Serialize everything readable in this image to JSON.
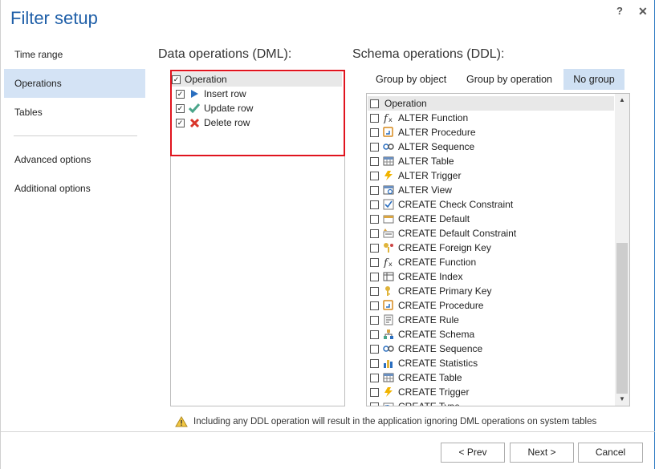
{
  "window": {
    "title": "Filter setup",
    "help_label": "?",
    "close_label": "✕"
  },
  "nav": {
    "items_top": [
      {
        "label": "Time range"
      },
      {
        "label": "Operations"
      },
      {
        "label": "Tables"
      }
    ],
    "items_bottom": [
      {
        "label": "Advanced options"
      },
      {
        "label": "Additional options"
      }
    ],
    "active": "Operations"
  },
  "dml": {
    "title": "Data operations (DML):",
    "header": {
      "label": "Operation",
      "checked": true
    },
    "items": [
      {
        "label": "Insert row",
        "checked": true,
        "icon": "play-arrow-icon",
        "color": "#2a6ebf"
      },
      {
        "label": "Update row",
        "checked": true,
        "icon": "checkmark-icon",
        "color": "#4aa58a"
      },
      {
        "label": "Delete row",
        "checked": true,
        "icon": "red-x-icon",
        "color": "#d9362b"
      }
    ]
  },
  "ddl": {
    "title": "Schema operations (DDL):",
    "tabs": [
      {
        "label": "Group by object"
      },
      {
        "label": "Group by operation"
      },
      {
        "label": "No group"
      }
    ],
    "active_tab": "No group",
    "header": {
      "label": "Operation",
      "checked": false
    },
    "items": [
      {
        "label": "ALTER Function",
        "icon": "function-icon"
      },
      {
        "label": "ALTER Procedure",
        "icon": "procedure-icon"
      },
      {
        "label": "ALTER Sequence",
        "icon": "sequence-icon"
      },
      {
        "label": "ALTER Table",
        "icon": "table-icon"
      },
      {
        "label": "ALTER Trigger",
        "icon": "trigger-icon"
      },
      {
        "label": "ALTER View",
        "icon": "view-icon"
      },
      {
        "label": "CREATE Check Constraint",
        "icon": "check-constraint-icon"
      },
      {
        "label": "CREATE Default",
        "icon": "default-icon"
      },
      {
        "label": "CREATE Default Constraint",
        "icon": "default-constraint-icon"
      },
      {
        "label": "CREATE Foreign Key",
        "icon": "foreign-key-icon"
      },
      {
        "label": "CREATE Function",
        "icon": "function-icon"
      },
      {
        "label": "CREATE Index",
        "icon": "index-icon"
      },
      {
        "label": "CREATE Primary Key",
        "icon": "primary-key-icon"
      },
      {
        "label": "CREATE Procedure",
        "icon": "procedure-icon"
      },
      {
        "label": "CREATE Rule",
        "icon": "rule-icon"
      },
      {
        "label": "CREATE Schema",
        "icon": "schema-icon"
      },
      {
        "label": "CREATE Sequence",
        "icon": "sequence-icon"
      },
      {
        "label": "CREATE Statistics",
        "icon": "statistics-icon"
      },
      {
        "label": "CREATE Table",
        "icon": "table-icon"
      },
      {
        "label": "CREATE Trigger",
        "icon": "trigger-icon"
      },
      {
        "label": "CREATE Type",
        "icon": "type-icon"
      }
    ]
  },
  "warning": {
    "text": "Including any DDL operation will result in the application ignoring DML operations on system tables",
    "icon": "warning-icon"
  },
  "buttons": {
    "prev": "< Prev",
    "next": "Next >",
    "cancel": "Cancel"
  },
  "colors": {
    "accent": "#1f5fa8",
    "selected_bg": "#d4e3f5",
    "highlight_border": "#e0141e"
  }
}
